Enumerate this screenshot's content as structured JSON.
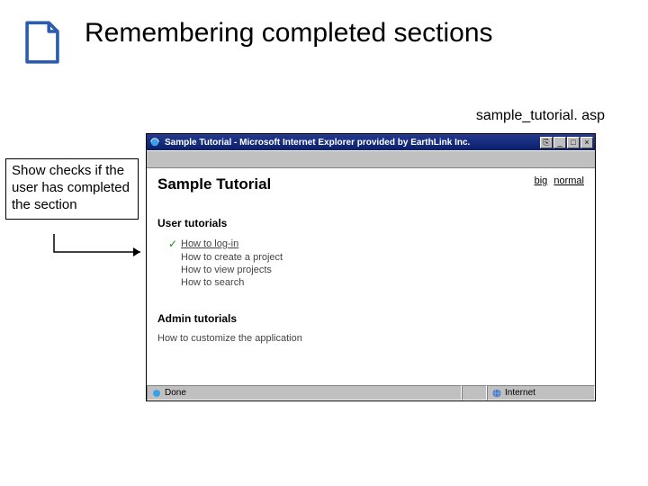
{
  "slide": {
    "title": "Remembering completed sections",
    "filename": "sample_tutorial. asp",
    "callout": "Show checks if the user has completed the section"
  },
  "browser": {
    "titlebar": "Sample Tutorial - Microsoft Internet Explorer provided by EarthLink Inc.",
    "win_buttons": {
      "min": "_",
      "max": "□",
      "close": "×",
      "extra": "⎘"
    },
    "page": {
      "heading": "Sample Tutorial",
      "sizes": {
        "big": "big",
        "normal": "normal"
      },
      "user_section": {
        "title": "User tutorials",
        "items": [
          {
            "checked": true,
            "label": "How to log-in"
          },
          {
            "checked": false,
            "label": "How to create a project"
          },
          {
            "checked": false,
            "label": "How to view projects"
          },
          {
            "checked": false,
            "label": "How to search"
          }
        ]
      },
      "admin_section": {
        "title": "Admin tutorials",
        "items": [
          {
            "checked": false,
            "label": "How to customize the application"
          }
        ]
      }
    },
    "status": {
      "left": "Done",
      "right": "Internet"
    }
  }
}
